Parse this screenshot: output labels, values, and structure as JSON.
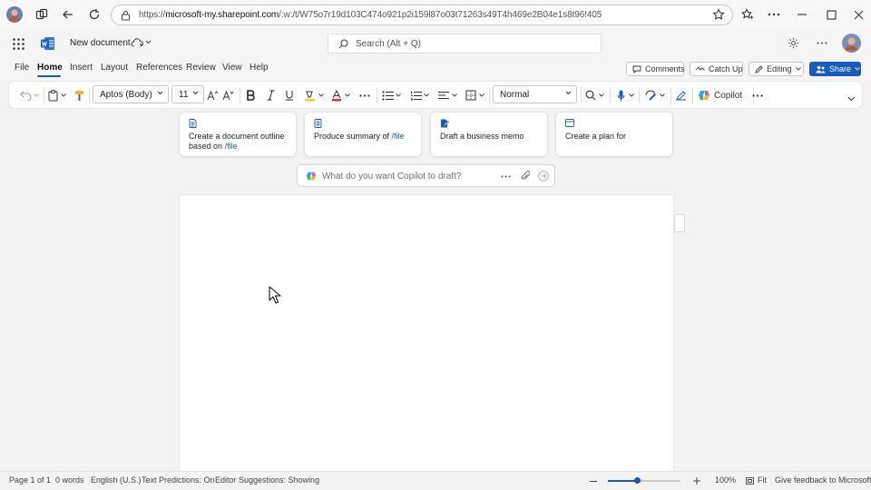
{
  "browser": {
    "url_prefix": "https://",
    "url_domain": "microsoft-my.sharepoint.com",
    "url_path": "/:w:/t/W75o7r19d103C474o921p2i159l87o03t71263s49T4h469e2B04e1s8t96!405"
  },
  "app": {
    "document_name": "New document",
    "search_placeholder": "Search (Alt + Q)"
  },
  "tabs": [
    "File",
    "Home",
    "Insert",
    "Layout",
    "References",
    "Review",
    "View",
    "Help"
  ],
  "actions": {
    "comments": "Comments",
    "catch_up": "Catch Up",
    "editing": "Editing",
    "share": "Share"
  },
  "ribbon": {
    "font_name": "Aptos (Body)",
    "font_size": "11",
    "style": "Normal",
    "copilot": "Copilot"
  },
  "copilot_suggestions": [
    {
      "text": "Create a document outline based on",
      "file_ref": "/file"
    },
    {
      "text": "Produce summary of",
      "file_ref": "/file"
    },
    {
      "text": "Draft a business memo",
      "file_ref": ""
    },
    {
      "text": "Create a plan for",
      "file_ref": ""
    }
  ],
  "copilot_prompt": {
    "placeholder": "What do you want Copilot to draft?"
  },
  "status": {
    "page": "Page 1 of 1",
    "words": "0 words",
    "language": "English (U.S.)",
    "text_predictions": "Text Predictions: On",
    "editor_suggestions": "Editor Suggestions: Showing",
    "zoom": "100%",
    "fit": "Fit",
    "feedback": "Give feedback to Microsoft",
    "zoom_level": 0.4
  },
  "colors": {
    "accent": "#185abd",
    "word_brand": "#185abd"
  }
}
